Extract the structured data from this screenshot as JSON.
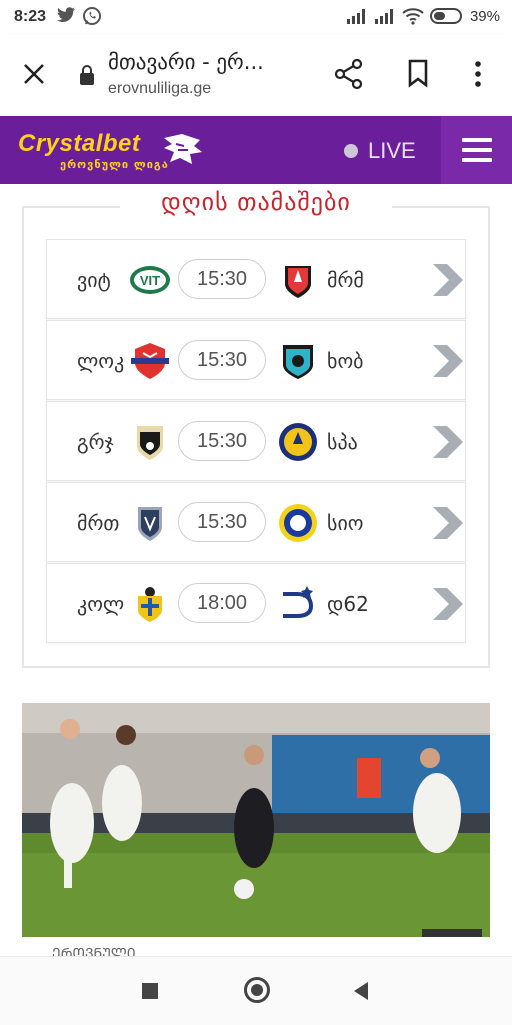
{
  "status_bar": {
    "time": "8:23",
    "battery": "39%"
  },
  "browser": {
    "page_title": "მთავარი - ერ...",
    "url": "erovnuliliga.ge"
  },
  "brand": {
    "logo": "Crystalbet",
    "sublogo": "ეროვნული ლიგა",
    "live_label": "LIVE"
  },
  "section": {
    "title": "დღის თამაშები"
  },
  "matches": [
    {
      "home": "ვიტ",
      "away": "მრმ",
      "time": "15:30",
      "home_badge": "vit-badge-icon",
      "away_badge": "mrm-badge-icon"
    },
    {
      "home": "ლოკ",
      "away": "ხობ",
      "time": "15:30",
      "home_badge": "lok-badge-icon",
      "away_badge": "khob-badge-icon"
    },
    {
      "home": "გრჯ",
      "away": "სპა",
      "time": "15:30",
      "home_badge": "grj-badge-icon",
      "away_badge": "spa-badge-icon"
    },
    {
      "home": "მრთ",
      "away": "სიო",
      "time": "15:30",
      "home_badge": "mrt-badge-icon",
      "away_badge": "sio-badge-icon"
    },
    {
      "home": "კოლ",
      "away": "დ62",
      "time": "18:00",
      "home_badge": "kol-badge-icon",
      "away_badge": "d62-badge-icon"
    }
  ],
  "article": {
    "caption": "ᲔᲠᲝᲕᲜᲣᲚᲘ"
  },
  "colors": {
    "brand_purple": "#6b1e9a",
    "brand_yellow": "#ffd21a",
    "title_red": "#c8232c",
    "arrow_gray": "#a8aeb4"
  }
}
